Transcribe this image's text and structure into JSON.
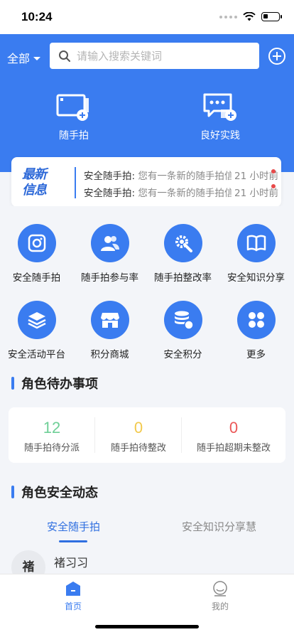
{
  "status_bar": {
    "time": "10:24"
  },
  "header": {
    "scope_label": "全部",
    "search_placeholder": "请输入搜索关键词",
    "quick_actions": [
      {
        "label": "随手拍",
        "icon": "photo-add-icon"
      },
      {
        "label": "良好实践",
        "icon": "chat-add-icon"
      }
    ]
  },
  "notice": {
    "badge_line1": "最新",
    "badge_line2": "信息",
    "items": [
      {
        "title": "安全随手拍:",
        "text": "您有一条新的随手拍信...",
        "time": "21 小时前"
      },
      {
        "title": "安全随手拍:",
        "text": "您有一条新的随手拍信...",
        "time": "21 小时前"
      }
    ]
  },
  "grid": [
    {
      "label": "安全随手拍",
      "icon": "camera-icon"
    },
    {
      "label": "随手拍参与率",
      "icon": "users-icon"
    },
    {
      "label": "随手拍整改率",
      "icon": "tools-icon"
    },
    {
      "label": "安全知识分享",
      "icon": "book-icon"
    },
    {
      "label": "安全活动平台",
      "icon": "layers-icon"
    },
    {
      "label": "积分商城",
      "icon": "store-icon"
    },
    {
      "label": "安全积分",
      "icon": "coins-icon"
    },
    {
      "label": "更多",
      "icon": "more-icon"
    }
  ],
  "todo": {
    "title": "角色待办事项",
    "items": [
      {
        "value": "12",
        "label": "随手拍待分派",
        "color": "#6fcf97"
      },
      {
        "value": "0",
        "label": "随手拍待整改",
        "color": "#f2c94c"
      },
      {
        "value": "0",
        "label": "随手拍超期未整改",
        "color": "#eb5757"
      }
    ]
  },
  "dynamics": {
    "title": "角色安全动态",
    "tabs": [
      {
        "label": "安全随手拍",
        "active": true
      },
      {
        "label": "安全知识分享慧",
        "active": false
      }
    ],
    "feed": [
      {
        "avatar_text": "褚",
        "name": "褚习习"
      }
    ]
  },
  "bottom_nav": {
    "items": [
      {
        "label": "首页",
        "icon": "home-icon",
        "active": true
      },
      {
        "label": "我的",
        "icon": "profile-icon",
        "active": false
      }
    ]
  },
  "colors": {
    "primary": "#3a7cf0",
    "background": "#f3f5f9"
  }
}
